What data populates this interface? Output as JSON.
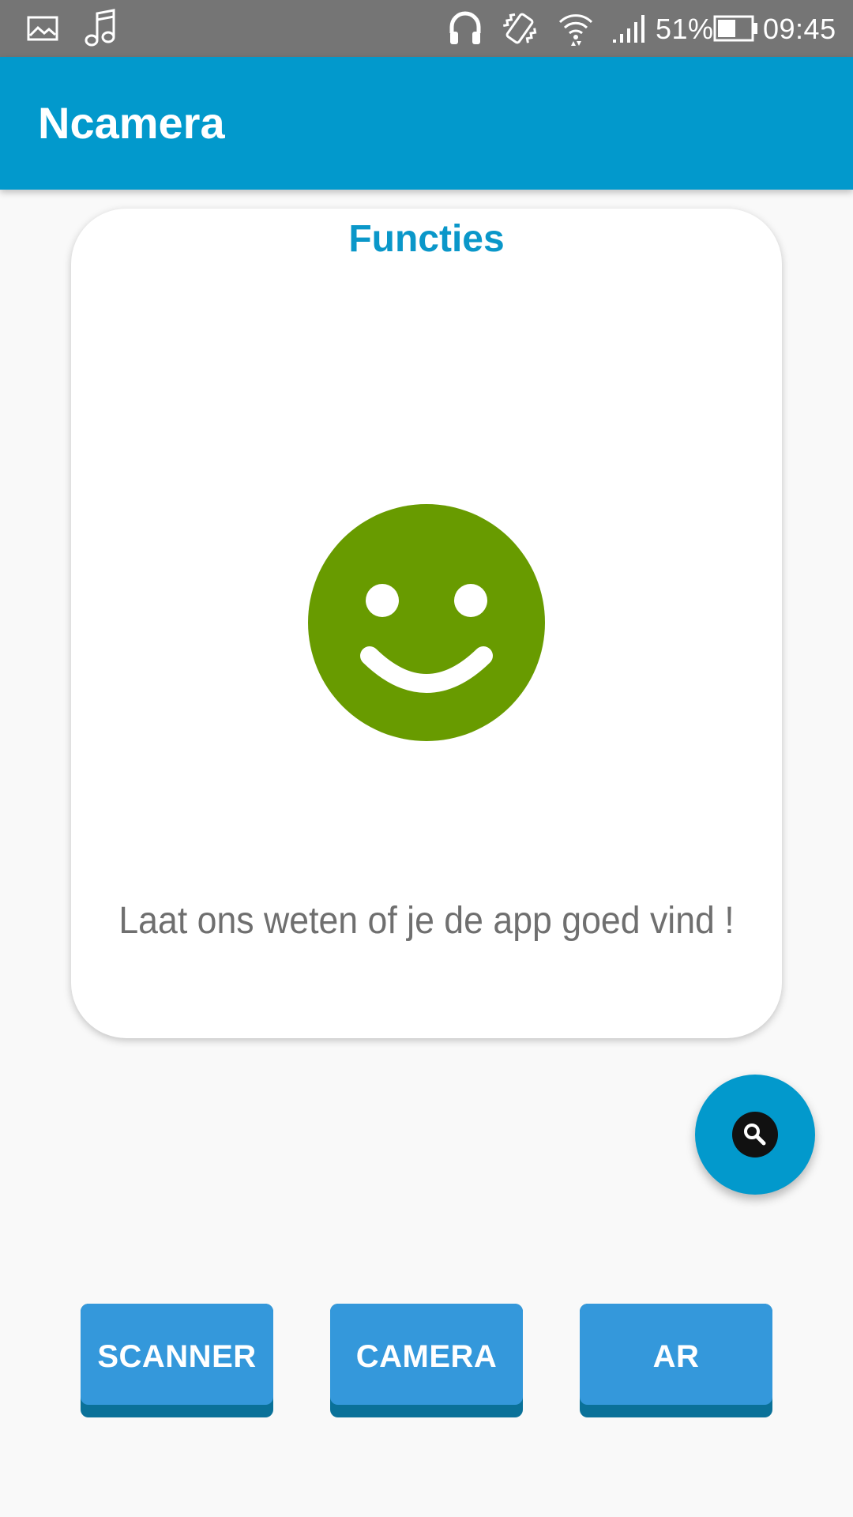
{
  "status_bar": {
    "battery_percent": "51%",
    "time": "09:45",
    "icons": [
      "image-icon",
      "music-note-icon",
      "headset-icon",
      "vibrate-icon",
      "wifi-icon",
      "signal-icon",
      "battery-icon"
    ]
  },
  "app_bar": {
    "title": "Ncamera",
    "color": "#0299cc"
  },
  "card": {
    "title": "Functies",
    "message": "Laat ons weten of je de app goed vind !",
    "smiley_color": "#689b00",
    "icon": "smiley-icon"
  },
  "fab": {
    "icon": "search-icon"
  },
  "buttons": {
    "scanner": "SCANNER",
    "camera": "CAMERA",
    "ar": "AR"
  },
  "colors": {
    "accent": "#0299cc",
    "button": "#3498db",
    "button_shadow": "#0a7199",
    "title_text": "#0a97c9"
  }
}
